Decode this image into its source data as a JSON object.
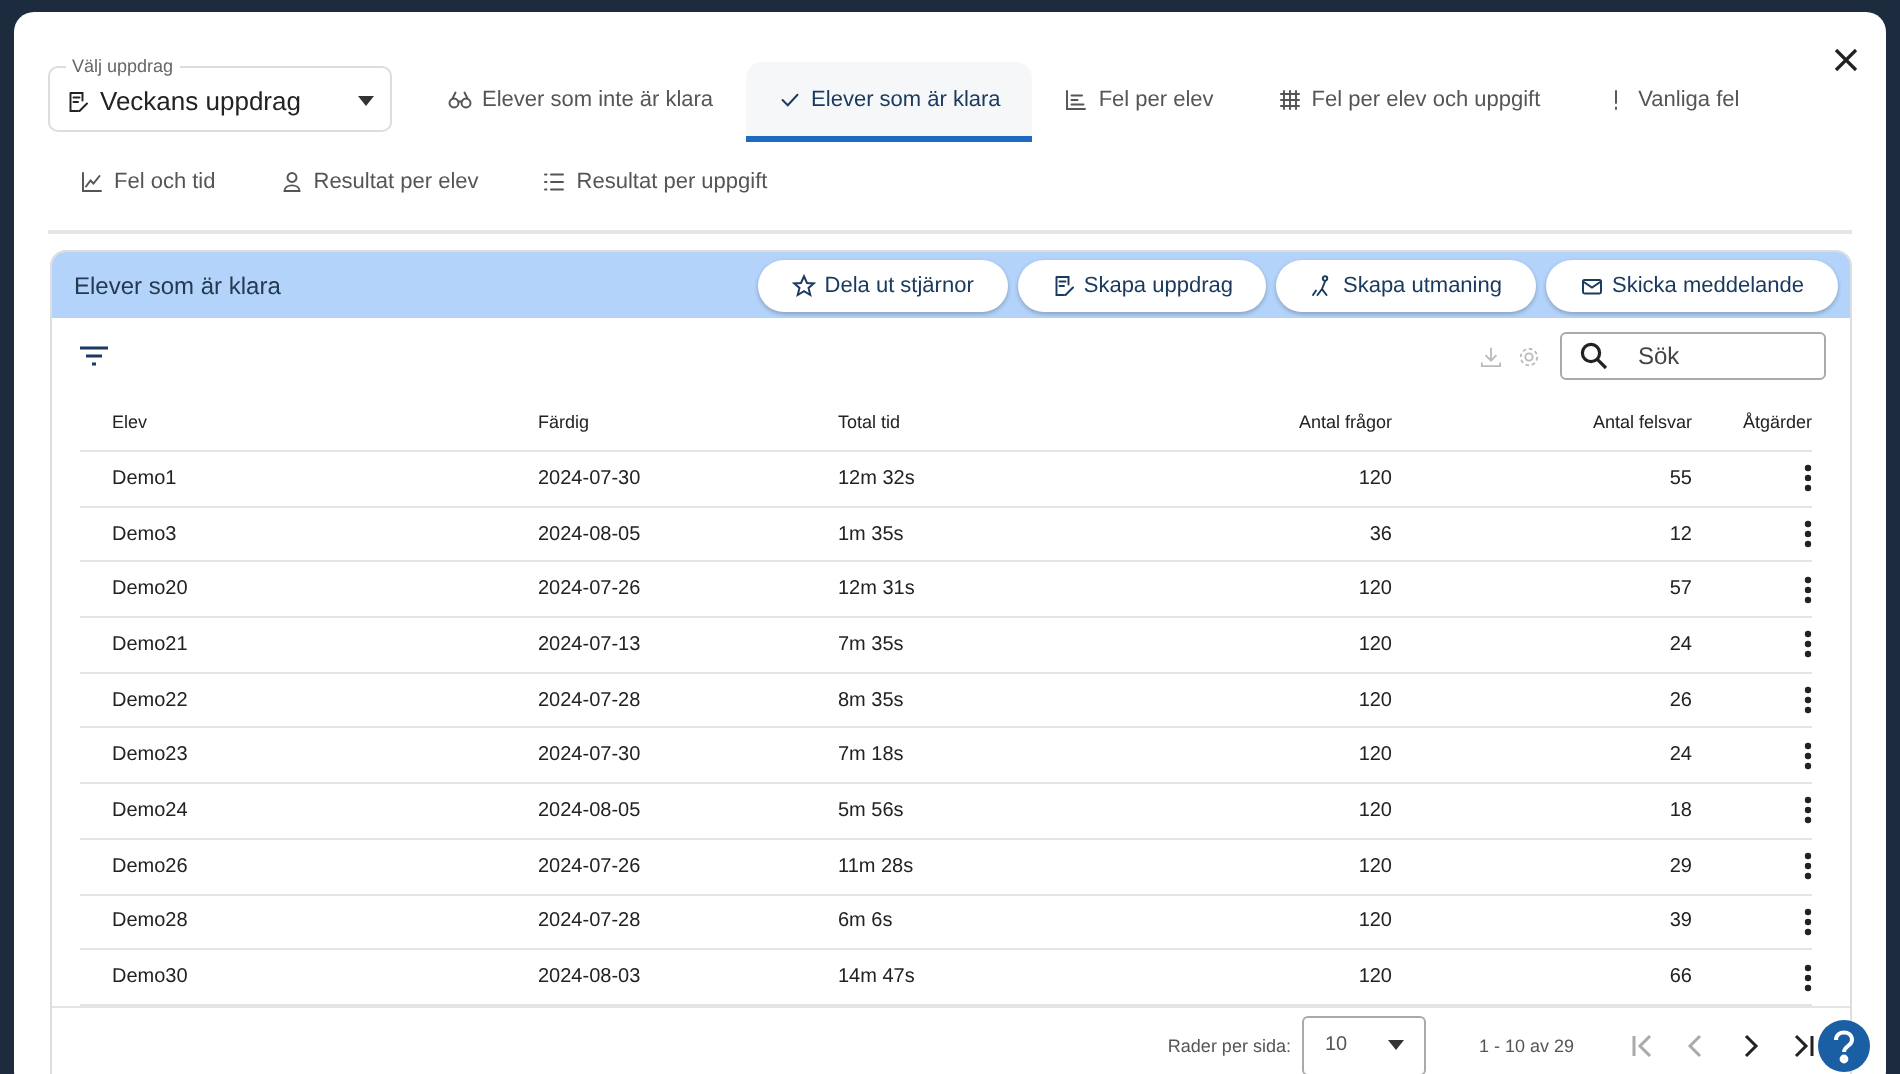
{
  "assignment_select": {
    "label": "Välj uppdrag",
    "value": "Veckans uppdrag"
  },
  "tabs": [
    {
      "label": "Elever som inte är klara",
      "kind": "binoculars",
      "selected": false
    },
    {
      "label": "Elever som är klara",
      "kind": "check",
      "selected": true
    },
    {
      "label": "Fel per elev",
      "kind": "bars",
      "selected": false
    },
    {
      "label": "Fel per elev och uppgift",
      "kind": "grid",
      "selected": false
    },
    {
      "label": "Vanliga fel",
      "kind": "exclaim",
      "selected": false
    },
    {
      "label": "Fel och tid",
      "kind": "chart",
      "selected": false
    },
    {
      "label": "Resultat per elev",
      "kind": "person",
      "selected": false
    },
    {
      "label": "Resultat per uppgift",
      "kind": "list",
      "selected": false
    }
  ],
  "panel": {
    "title": "Elever som är klara",
    "actions": [
      {
        "label": "Dela ut stjärnor",
        "kind": "star"
      },
      {
        "label": "Skapa uppdrag",
        "kind": "edit"
      },
      {
        "label": "Skapa utmaning",
        "kind": "climb"
      },
      {
        "label": "Skicka meddelande",
        "kind": "mail"
      }
    ],
    "search": {
      "placeholder": "Sök"
    }
  },
  "table": {
    "columns": [
      "Elev",
      "Färdig",
      "Total tid",
      "Antal frågor",
      "Antal felsvar",
      "Åtgärder"
    ],
    "rows": [
      [
        "Demo1",
        "2024-07-30",
        "12m 32s",
        "120",
        "55"
      ],
      [
        "Demo3",
        "2024-08-05",
        "1m 35s",
        "36",
        "12"
      ],
      [
        "Demo20",
        "2024-07-26",
        "12m 31s",
        "120",
        "57"
      ],
      [
        "Demo21",
        "2024-07-13",
        "7m 35s",
        "120",
        "24"
      ],
      [
        "Demo22",
        "2024-07-28",
        "8m 35s",
        "120",
        "26"
      ],
      [
        "Demo23",
        "2024-07-30",
        "7m 18s",
        "120",
        "24"
      ],
      [
        "Demo24",
        "2024-08-05",
        "5m 56s",
        "120",
        "18"
      ],
      [
        "Demo26",
        "2024-07-26",
        "11m 28s",
        "120",
        "29"
      ],
      [
        "Demo28",
        "2024-07-28",
        "6m 6s",
        "120",
        "39"
      ],
      [
        "Demo30",
        "2024-08-03",
        "14m 47s",
        "120",
        "66"
      ]
    ]
  },
  "pagination": {
    "rows_label": "Rader per sida:",
    "rows_per_page": "10",
    "range": "1 - 10 av 29",
    "buttons": [
      {
        "kind": "first",
        "disabled": true
      },
      {
        "kind": "prev",
        "disabled": true
      },
      {
        "kind": "next",
        "disabled": false
      },
      {
        "kind": "last",
        "disabled": false
      }
    ]
  }
}
